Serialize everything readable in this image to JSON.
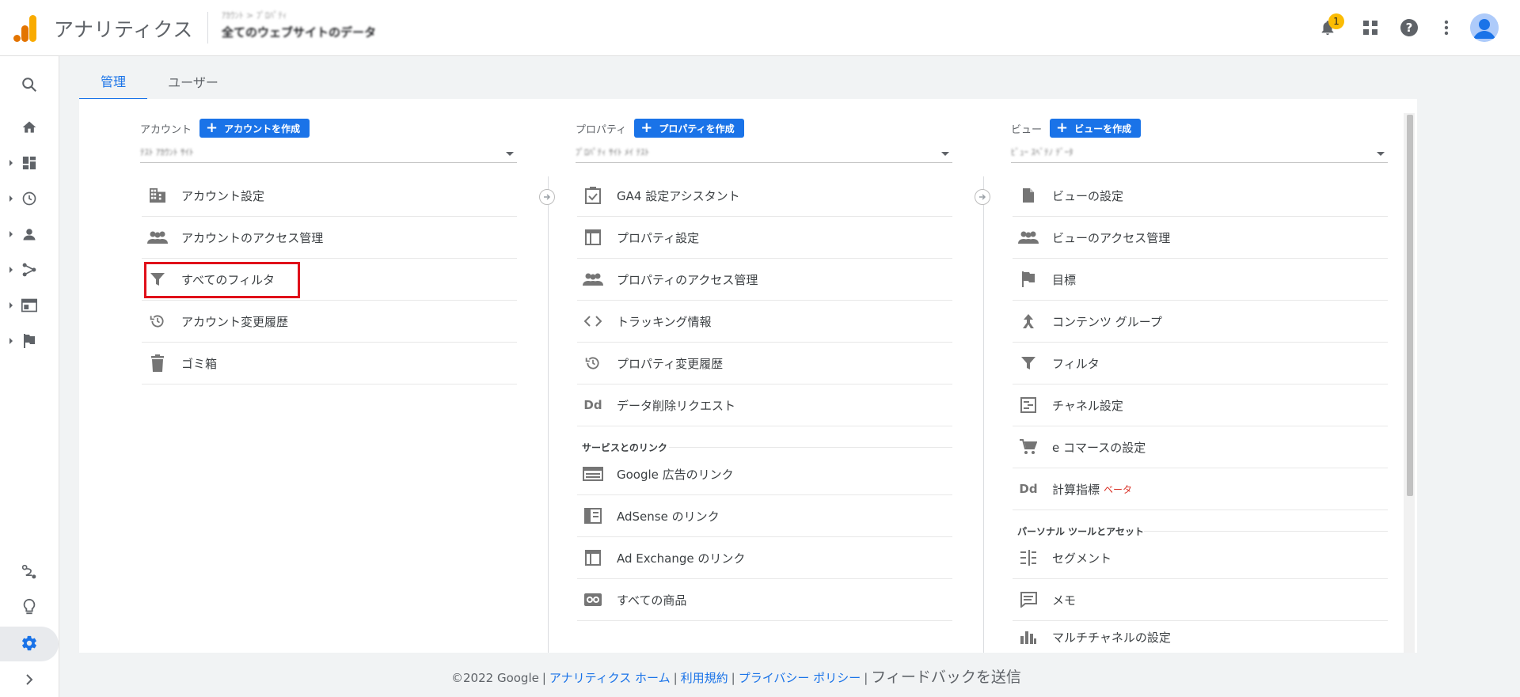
{
  "header": {
    "app_title": "アナリティクス",
    "account_path": "ｱｶｳﾝﾄ > ﾌﾟﾛﾊﾟﾃｨ",
    "view_name": "全てのウェブサイトのデータ",
    "notification_count": "1"
  },
  "tabs": [
    {
      "label": "管理"
    },
    {
      "label": "ユーザー"
    }
  ],
  "account": {
    "label": "アカウント",
    "create_label": "アカウントを作成",
    "selected": "ﾃｽﾄ ｱｶｳﾝﾄ ｻｲﾄ",
    "items": [
      {
        "label": "アカウント設定",
        "icon": "building-icon"
      },
      {
        "label": "アカウントのアクセス管理",
        "icon": "people-icon"
      },
      {
        "label": "すべてのフィルタ",
        "icon": "filter-icon"
      },
      {
        "label": "アカウント変更履歴",
        "icon": "history-icon"
      },
      {
        "label": "ゴミ箱",
        "icon": "trash-icon"
      }
    ]
  },
  "property": {
    "label": "プロパティ",
    "create_label": "プロパティを作成",
    "selected": "ﾌﾟﾛﾊﾟﾃｨ ｻｲﾄ ﾒｲ ﾃｽﾄ",
    "items": [
      {
        "label": "GA4 設定アシスタント",
        "icon": "checkbox-icon"
      },
      {
        "label": "プロパティ設定",
        "icon": "layout-icon"
      },
      {
        "label": "プロパティのアクセス管理",
        "icon": "people-icon"
      },
      {
        "label": "トラッキング情報",
        "icon": "code-icon"
      },
      {
        "label": "プロパティ変更履歴",
        "icon": "history-icon"
      },
      {
        "label": "データ削除リクエスト",
        "icon": "dd-icon",
        "icon_text": "Dd"
      }
    ],
    "links_section": "サービスとのリンク",
    "link_items": [
      {
        "label": "Google 広告のリンク",
        "icon": "ads-icon"
      },
      {
        "label": "AdSense のリンク",
        "icon": "adsense-icon"
      },
      {
        "label": "Ad Exchange のリンク",
        "icon": "adexchange-icon"
      },
      {
        "label": "すべての商品",
        "icon": "link-icon"
      }
    ]
  },
  "view": {
    "label": "ビュー",
    "create_label": "ビューを作成",
    "selected": "ﾋﾞｭｰ ｽﾍﾞﾃﾉ ﾃﾞｰﾀ",
    "items": [
      {
        "label": "ビューの設定",
        "icon": "document-icon"
      },
      {
        "label": "ビューのアクセス管理",
        "icon": "people-icon"
      },
      {
        "label": "目標",
        "icon": "flag-icon"
      },
      {
        "label": "コンテンツ グループ",
        "icon": "content-group-icon"
      },
      {
        "label": "フィルタ",
        "icon": "filter-icon"
      },
      {
        "label": "チャネル設定",
        "icon": "channel-icon"
      },
      {
        "label": "e コマースの設定",
        "icon": "cart-icon"
      },
      {
        "label": "計算指標",
        "icon": "dd-icon",
        "icon_text": "Dd",
        "badge": "ベータ"
      }
    ],
    "tools_section": "パーソナル ツールとアセット",
    "tool_items": [
      {
        "label": "セグメント",
        "icon": "segment-icon"
      },
      {
        "label": "メモ",
        "icon": "note-icon"
      },
      {
        "label": "マルチチャネルの設定",
        "icon": "bar-chart-icon"
      }
    ]
  },
  "footer": {
    "copyright": "©2022 Google",
    "links": [
      "アナリティクス ホーム",
      "利用規約",
      "プライバシー ポリシー"
    ],
    "feedback": "フィードバックを送信"
  },
  "colors": {
    "accent": "#1a73e8",
    "highlight": "#e0101a",
    "badge": "#fbbc04",
    "logo_orange": "#f9ab00",
    "logo_dark": "#e37400"
  }
}
